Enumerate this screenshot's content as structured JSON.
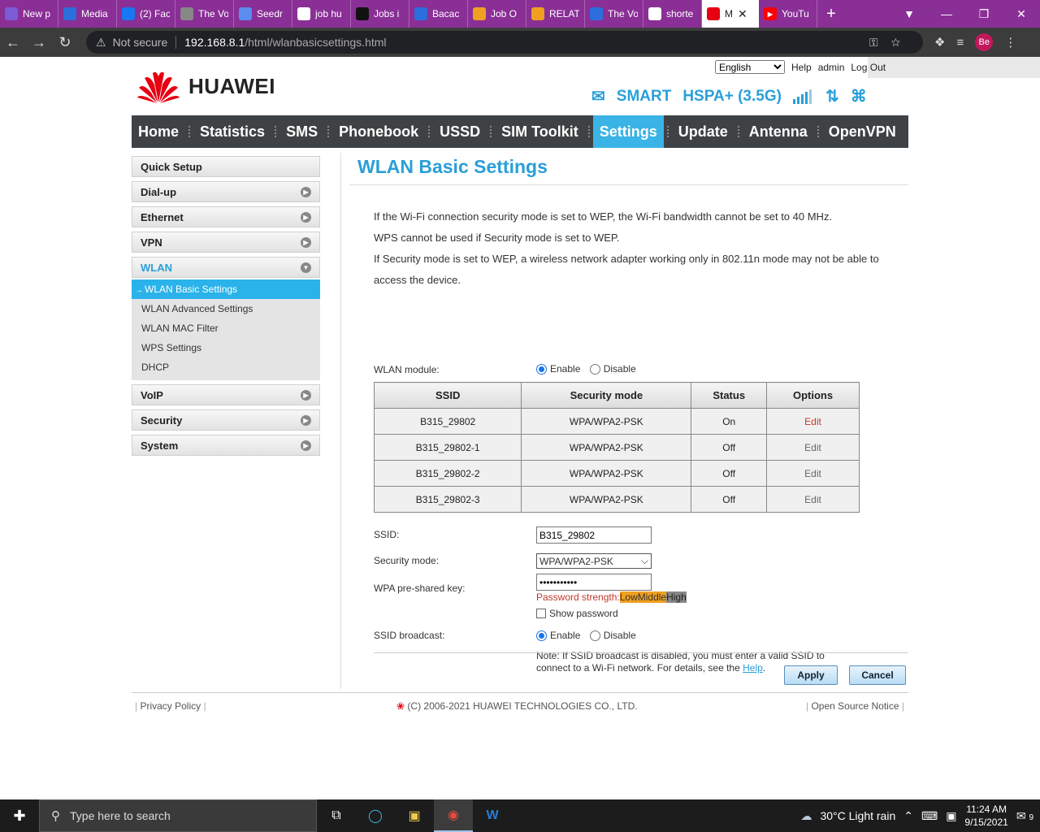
{
  "browser": {
    "tabs": [
      {
        "label": "New p",
        "icon": "shield-icon",
        "color": "#7b5cd6"
      },
      {
        "label": "Media",
        "icon": "eye-icon",
        "color": "#2a6fdb"
      },
      {
        "label": "(2) Fac",
        "icon": "facebook-icon",
        "color": "#1877f2"
      },
      {
        "label": "The Vo",
        "icon": "globe-icon",
        "color": "#888888"
      },
      {
        "label": "Seedr",
        "icon": "seed-icon",
        "color": "#5b8def"
      },
      {
        "label": "job hu",
        "icon": "google-icon",
        "color": "#ffffff"
      },
      {
        "label": "Jobs i",
        "icon": "j-icon",
        "color": "#111111"
      },
      {
        "label": "Bacac",
        "icon": "infinity-icon",
        "color": "#2a6fdb"
      },
      {
        "label": "Job O",
        "icon": "bolt-icon",
        "color": "#f0a020"
      },
      {
        "label": "RELAT",
        "icon": "bolt-icon",
        "color": "#f0a020"
      },
      {
        "label": "The Vo",
        "icon": "eye-icon",
        "color": "#2a6fdb"
      },
      {
        "label": "shorte",
        "icon": "google-icon",
        "color": "#ffffff"
      }
    ],
    "active_tab": {
      "label": "M",
      "icon": "huawei-icon"
    },
    "tab_after": {
      "label": "YouTu",
      "icon": "youtube-icon"
    },
    "not_secure": "Not secure",
    "url_host": "192.168.8.1",
    "url_path": "/html/wlanbasicsettings.html",
    "avatar": "Be"
  },
  "topbar": {
    "language": "English",
    "help": "Help",
    "user": "admin",
    "logout": "Log Out"
  },
  "logo": {
    "word": "HUAWEI",
    "brand_color": "#e60012"
  },
  "status": {
    "mail_icon": "mail-icon",
    "operator": "SMART",
    "network": "HSPA+ (3.5G)",
    "accent": "#2aa0d8"
  },
  "menu": [
    "Home",
    "Statistics",
    "SMS",
    "Phonebook",
    "USSD",
    "SIM Toolkit",
    "Settings",
    "Update",
    "Antenna",
    "OpenVPN"
  ],
  "menu_active": "Settings",
  "sidebar": {
    "top": [
      {
        "label": "Quick Setup",
        "arrow": false
      },
      {
        "label": "Dial-up",
        "arrow": true
      },
      {
        "label": "Ethernet",
        "arrow": true
      },
      {
        "label": "VPN",
        "arrow": true
      }
    ],
    "open": {
      "label": "WLAN"
    },
    "sub": [
      {
        "label": "WLAN Basic Settings",
        "active": true
      },
      {
        "label": "WLAN Advanced Settings",
        "active": false
      },
      {
        "label": "WLAN MAC Filter",
        "active": false
      },
      {
        "label": "WPS Settings",
        "active": false
      },
      {
        "label": "DHCP",
        "active": false
      }
    ],
    "bottom": [
      {
        "label": "VoIP"
      },
      {
        "label": "Security"
      },
      {
        "label": "System"
      }
    ]
  },
  "content": {
    "title": "WLAN Basic Settings",
    "notes": [
      "If the Wi-Fi connection security mode is set to WEP, the Wi-Fi bandwidth cannot be set to 40 MHz.",
      "WPS cannot be used if Security mode is set to WEP.",
      "If Security mode is set to WEP, a wireless network adapter working only in 802.11n mode may not be able to access the device."
    ],
    "wlan_module_label": "WLAN module:",
    "enable": "Enable",
    "disable": "Disable",
    "table": {
      "headers": [
        "SSID",
        "Security mode",
        "Status",
        "Options"
      ],
      "rows": [
        [
          "B315_29802",
          "WPA/WPA2-PSK",
          "On",
          "Edit"
        ],
        [
          "B315_29802-1",
          "WPA/WPA2-PSK",
          "Off",
          "Edit"
        ],
        [
          "B315_29802-2",
          "WPA/WPA2-PSK",
          "Off",
          "Edit"
        ],
        [
          "B315_29802-3",
          "WPA/WPA2-PSK",
          "Off",
          "Edit"
        ]
      ]
    },
    "ssid_label": "SSID:",
    "ssid_value": "B315_29802",
    "security_label": "Security mode:",
    "security_value": "WPA/WPA2-PSK",
    "psk_label": "WPA pre-shared key:",
    "psk_value": "•••••••••••",
    "strength_label": "Password strength:",
    "strength_low": "Low",
    "strength_mid": "Middle",
    "strength_high": "High",
    "show_password": "Show password",
    "broadcast_label": "SSID broadcast:",
    "note_text": "Note: If SSID broadcast is disabled, you must enter a valid SSID to connect to a Wi-Fi network. For details, see the ",
    "note_link": "Help",
    "apply": "Apply",
    "cancel": "Cancel"
  },
  "footer": {
    "privacy": "Privacy Policy",
    "copyright": "(C) 2006-2021 HUAWEI TECHNOLOGIES CO., LTD.",
    "open_source": "Open Source Notice"
  },
  "taskbar": {
    "search_placeholder": "Type here to search",
    "weather": "30°C  Light rain",
    "time": "11:24 AM",
    "date": "9/15/2021",
    "notifications": "9"
  }
}
